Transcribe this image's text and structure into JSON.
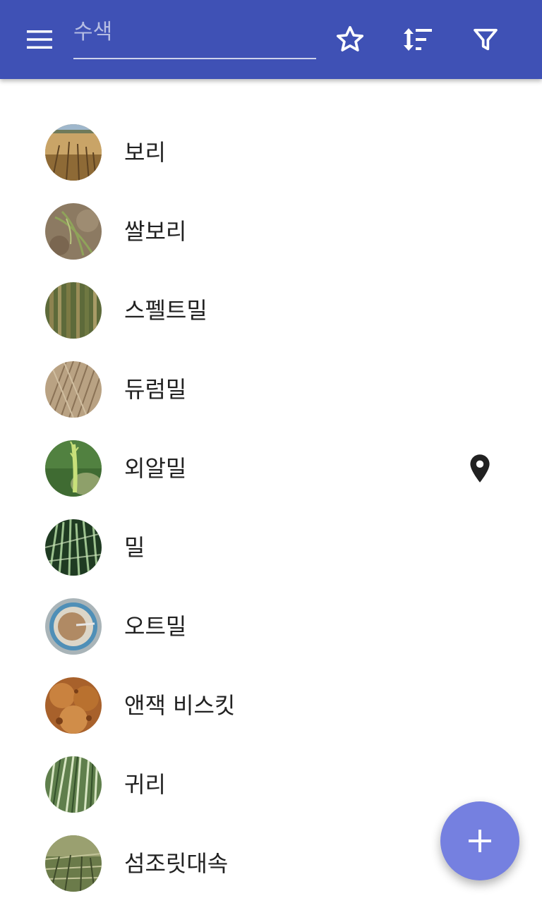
{
  "app_bar": {
    "menu_icon": "menu-icon",
    "search": {
      "placeholder": "수색",
      "value": ""
    },
    "actions": [
      {
        "name": "favorites",
        "icon": "star-outline-icon"
      },
      {
        "name": "sort",
        "icon": "sort-icon"
      },
      {
        "name": "filter",
        "icon": "filter-icon"
      }
    ],
    "background_color": "#3f51b5"
  },
  "list": {
    "items": [
      {
        "label": "보리",
        "has_location": false
      },
      {
        "label": "쌀보리",
        "has_location": false
      },
      {
        "label": "스펠트밀",
        "has_location": false
      },
      {
        "label": "듀럼밀",
        "has_location": false
      },
      {
        "label": "외알밀",
        "has_location": true
      },
      {
        "label": "밀",
        "has_location": false
      },
      {
        "label": "오트밀",
        "has_location": false
      },
      {
        "label": "앤잭 비스킷",
        "has_location": false
      },
      {
        "label": "귀리",
        "has_location": false
      },
      {
        "label": "섬조릿대속",
        "has_location": false
      }
    ]
  },
  "fab": {
    "icon": "plus-icon",
    "color": "#7580e0"
  }
}
